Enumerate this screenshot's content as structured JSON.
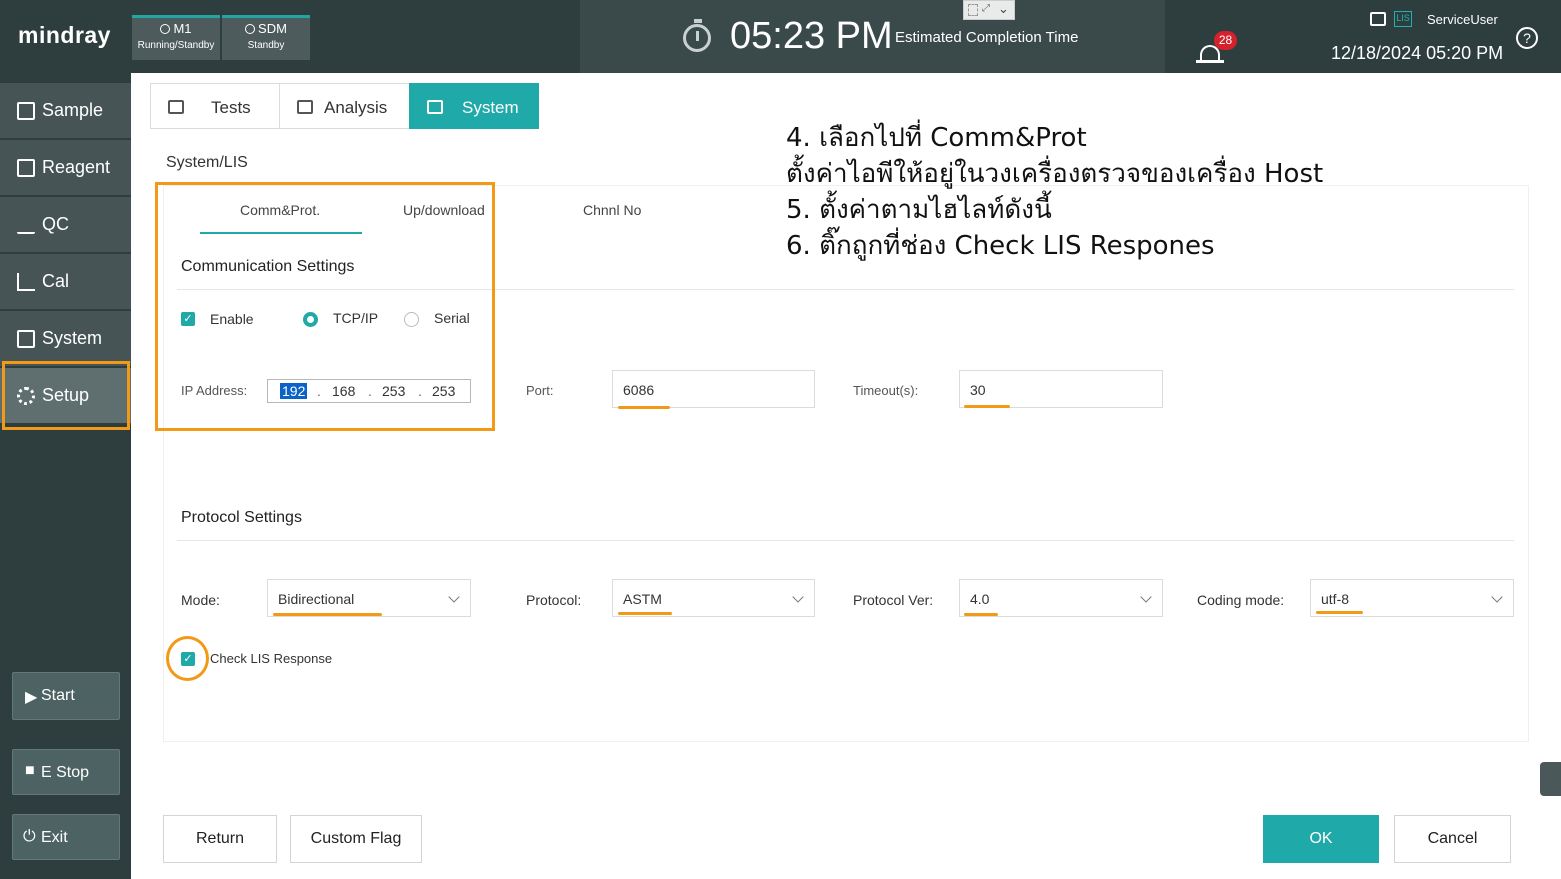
{
  "header": {
    "logo": "mindray",
    "modules": [
      {
        "name": "M1",
        "state": "Running/Standby"
      },
      {
        "name": "SDM",
        "state": "Standby"
      }
    ],
    "time": "05:23 PM",
    "estimated_label": "Estimated Completion Time",
    "alarm_count": "28",
    "lis_icon_text": "LIS",
    "user": "ServiceUser",
    "datetime": "12/18/2024 05:20 PM",
    "help": "?"
  },
  "sidebar": {
    "items": [
      {
        "label": "Sample",
        "icon": "sample-icon"
      },
      {
        "label": "Reagent",
        "icon": "reagent-icon"
      },
      {
        "label": "QC",
        "icon": "qc-icon"
      },
      {
        "label": "Cal",
        "icon": "cal-icon"
      },
      {
        "label": "System",
        "icon": "system-icon"
      },
      {
        "label": "Setup",
        "icon": "gear-icon"
      }
    ],
    "start": "Start",
    "estop": "E Stop",
    "exit": "Exit"
  },
  "tabs": [
    {
      "label": "Tests"
    },
    {
      "label": "Analysis"
    },
    {
      "label": "System"
    }
  ],
  "breadcrumb": "System/LIS",
  "subtabs": [
    "Comm&Prot.",
    "Up/download",
    "Chnnl No"
  ],
  "comm": {
    "title": "Communication Settings",
    "enable": "Enable",
    "tcpip": "TCP/IP",
    "serial": "Serial",
    "ip_label": "IP Address:",
    "ip": [
      "192",
      "168",
      "253",
      "253"
    ],
    "port_label": "Port:",
    "port": "6086",
    "timeout_label": "Timeout(s):",
    "timeout": "30"
  },
  "protocol": {
    "title": "Protocol Settings",
    "mode_label": "Mode:",
    "mode": "Bidirectional",
    "protocol_label": "Protocol:",
    "protocol": "ASTM",
    "ver_label": "Protocol Ver:",
    "ver": "4.0",
    "coding_label": "Coding mode:",
    "coding": "utf-8",
    "check_lis": "Check LIS Response"
  },
  "notes": [
    "4. เลือกไปที่ Comm&Prot",
    "ตั้งค่าไอพีให้อยู่ในวงเครื่องตรวจของเครื่อง Host",
    "5. ตั้งค่าตามไฮไลท์ดังนี้",
    "6. ติ๊กถูกที่ช่อง Check LIS Respones"
  ],
  "buttons": {
    "return": "Return",
    "custom_flag": "Custom Flag",
    "ok": "OK",
    "cancel": "Cancel"
  },
  "colors": {
    "accent": "#1fa9a8",
    "highlight": "#f29a17",
    "sidebar": "#2e3d3e",
    "alarm": "#d4212b"
  }
}
